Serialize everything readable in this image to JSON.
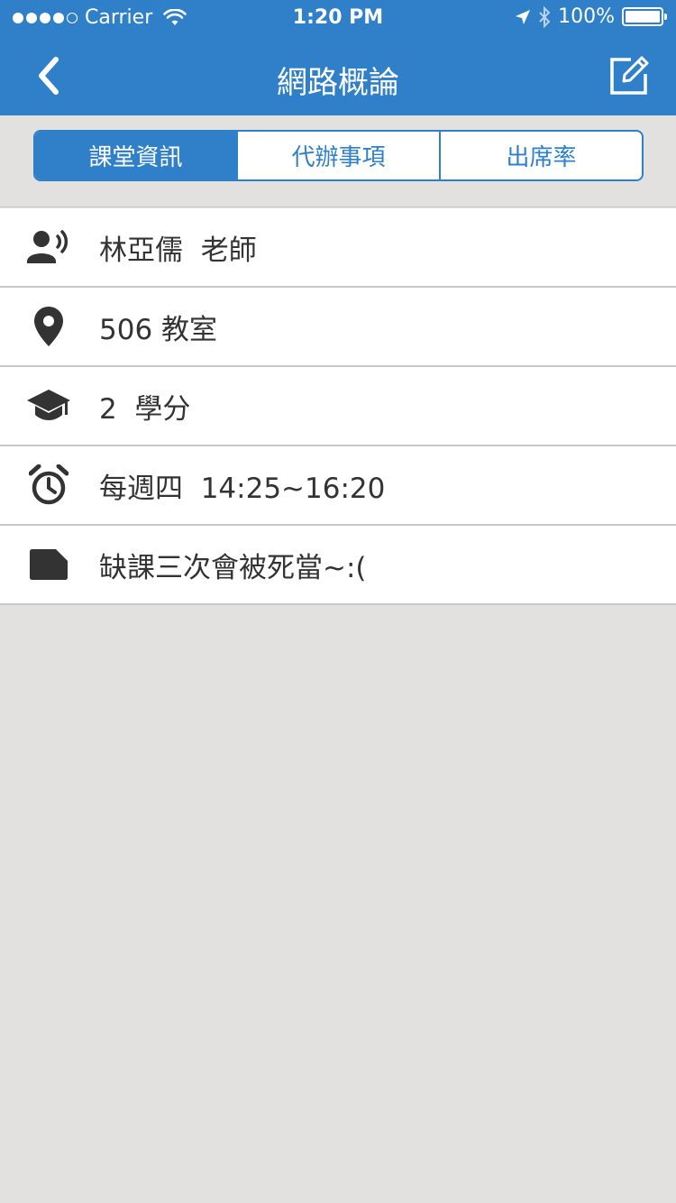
{
  "status_bar": {
    "carrier": "Carrier",
    "time": "1:20 PM",
    "battery": "100%",
    "battery_level": 1.0
  },
  "nav": {
    "title": "網路概論",
    "back_icon": "chevron-left-icon",
    "edit_icon": "edit-icon"
  },
  "tabs": [
    {
      "label": "課堂資訊",
      "active": true
    },
    {
      "label": "代辦事項",
      "active": false
    },
    {
      "label": "出席率",
      "active": false
    }
  ],
  "info": {
    "teacher": {
      "icon": "speaking-person-icon",
      "text": "林亞儒  老師"
    },
    "location": {
      "icon": "map-pin-icon",
      "text": "506 教室"
    },
    "credits": {
      "icon": "graduation-cap-icon",
      "text": "2  學分"
    },
    "schedule": {
      "icon": "alarm-clock-icon",
      "text": "每週四  14:25~16:20"
    },
    "note": {
      "icon": "note-icon",
      "text": "缺課三次會被死當~:("
    }
  },
  "colors": {
    "primary": "#2f80c8",
    "background": "#e3e0e0",
    "icon": "#333333"
  }
}
